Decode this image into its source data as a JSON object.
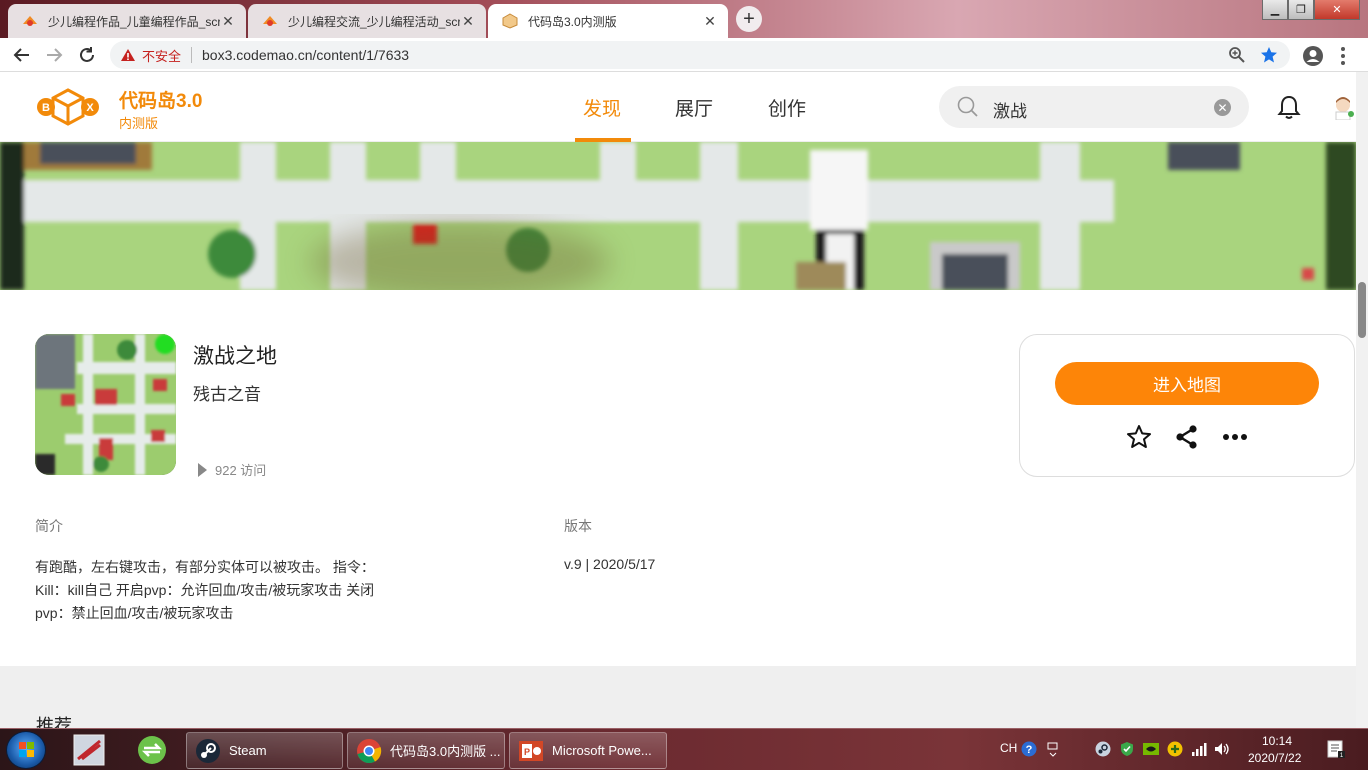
{
  "browser": {
    "tabs": [
      {
        "title": "少儿编程作品_儿童编程作品_scra",
        "active": false
      },
      {
        "title": "少儿编程交流_少儿编程活动_scra",
        "active": false
      },
      {
        "title": "代码岛3.0内测版",
        "active": true
      }
    ],
    "close_glyph": "✕",
    "new_tab_glyph": "+",
    "security_label": "不安全",
    "url": "box3.codemao.cn/content/1/7633"
  },
  "site": {
    "brand": "代码岛3.0",
    "brand_sub": "内测版",
    "nav": [
      {
        "label": "发现",
        "active": true
      },
      {
        "label": "展厅",
        "active": false
      },
      {
        "label": "创作",
        "active": false
      }
    ],
    "search_value": "激战"
  },
  "game": {
    "title": "激战之地",
    "author": "残古之音",
    "visits": "922 访问",
    "enter_button": "进入地图",
    "intro_label": "简介",
    "description_lines": [
      "有跑酷，左右键攻击，有部分实体可以被攻击。 指令：",
      "Kill：kill自己 开启pvp：允许回血/攻击/被玩家攻击 关闭",
      "pvp：禁止回血/攻击/被玩家攻击"
    ],
    "version_label": "版本",
    "version": "v.9 | 2020/5/17"
  },
  "recommend_title": "推荐",
  "taskbar": {
    "items": [
      {
        "label": "Steam"
      },
      {
        "label": "代码岛3.0内测版 ..."
      },
      {
        "label": "Microsoft Powe..."
      }
    ],
    "lang": "CH",
    "time": "10:14",
    "date": "2020/7/22"
  },
  "colors": {
    "accent": "#fd8508",
    "brand": "#f28a0a"
  }
}
